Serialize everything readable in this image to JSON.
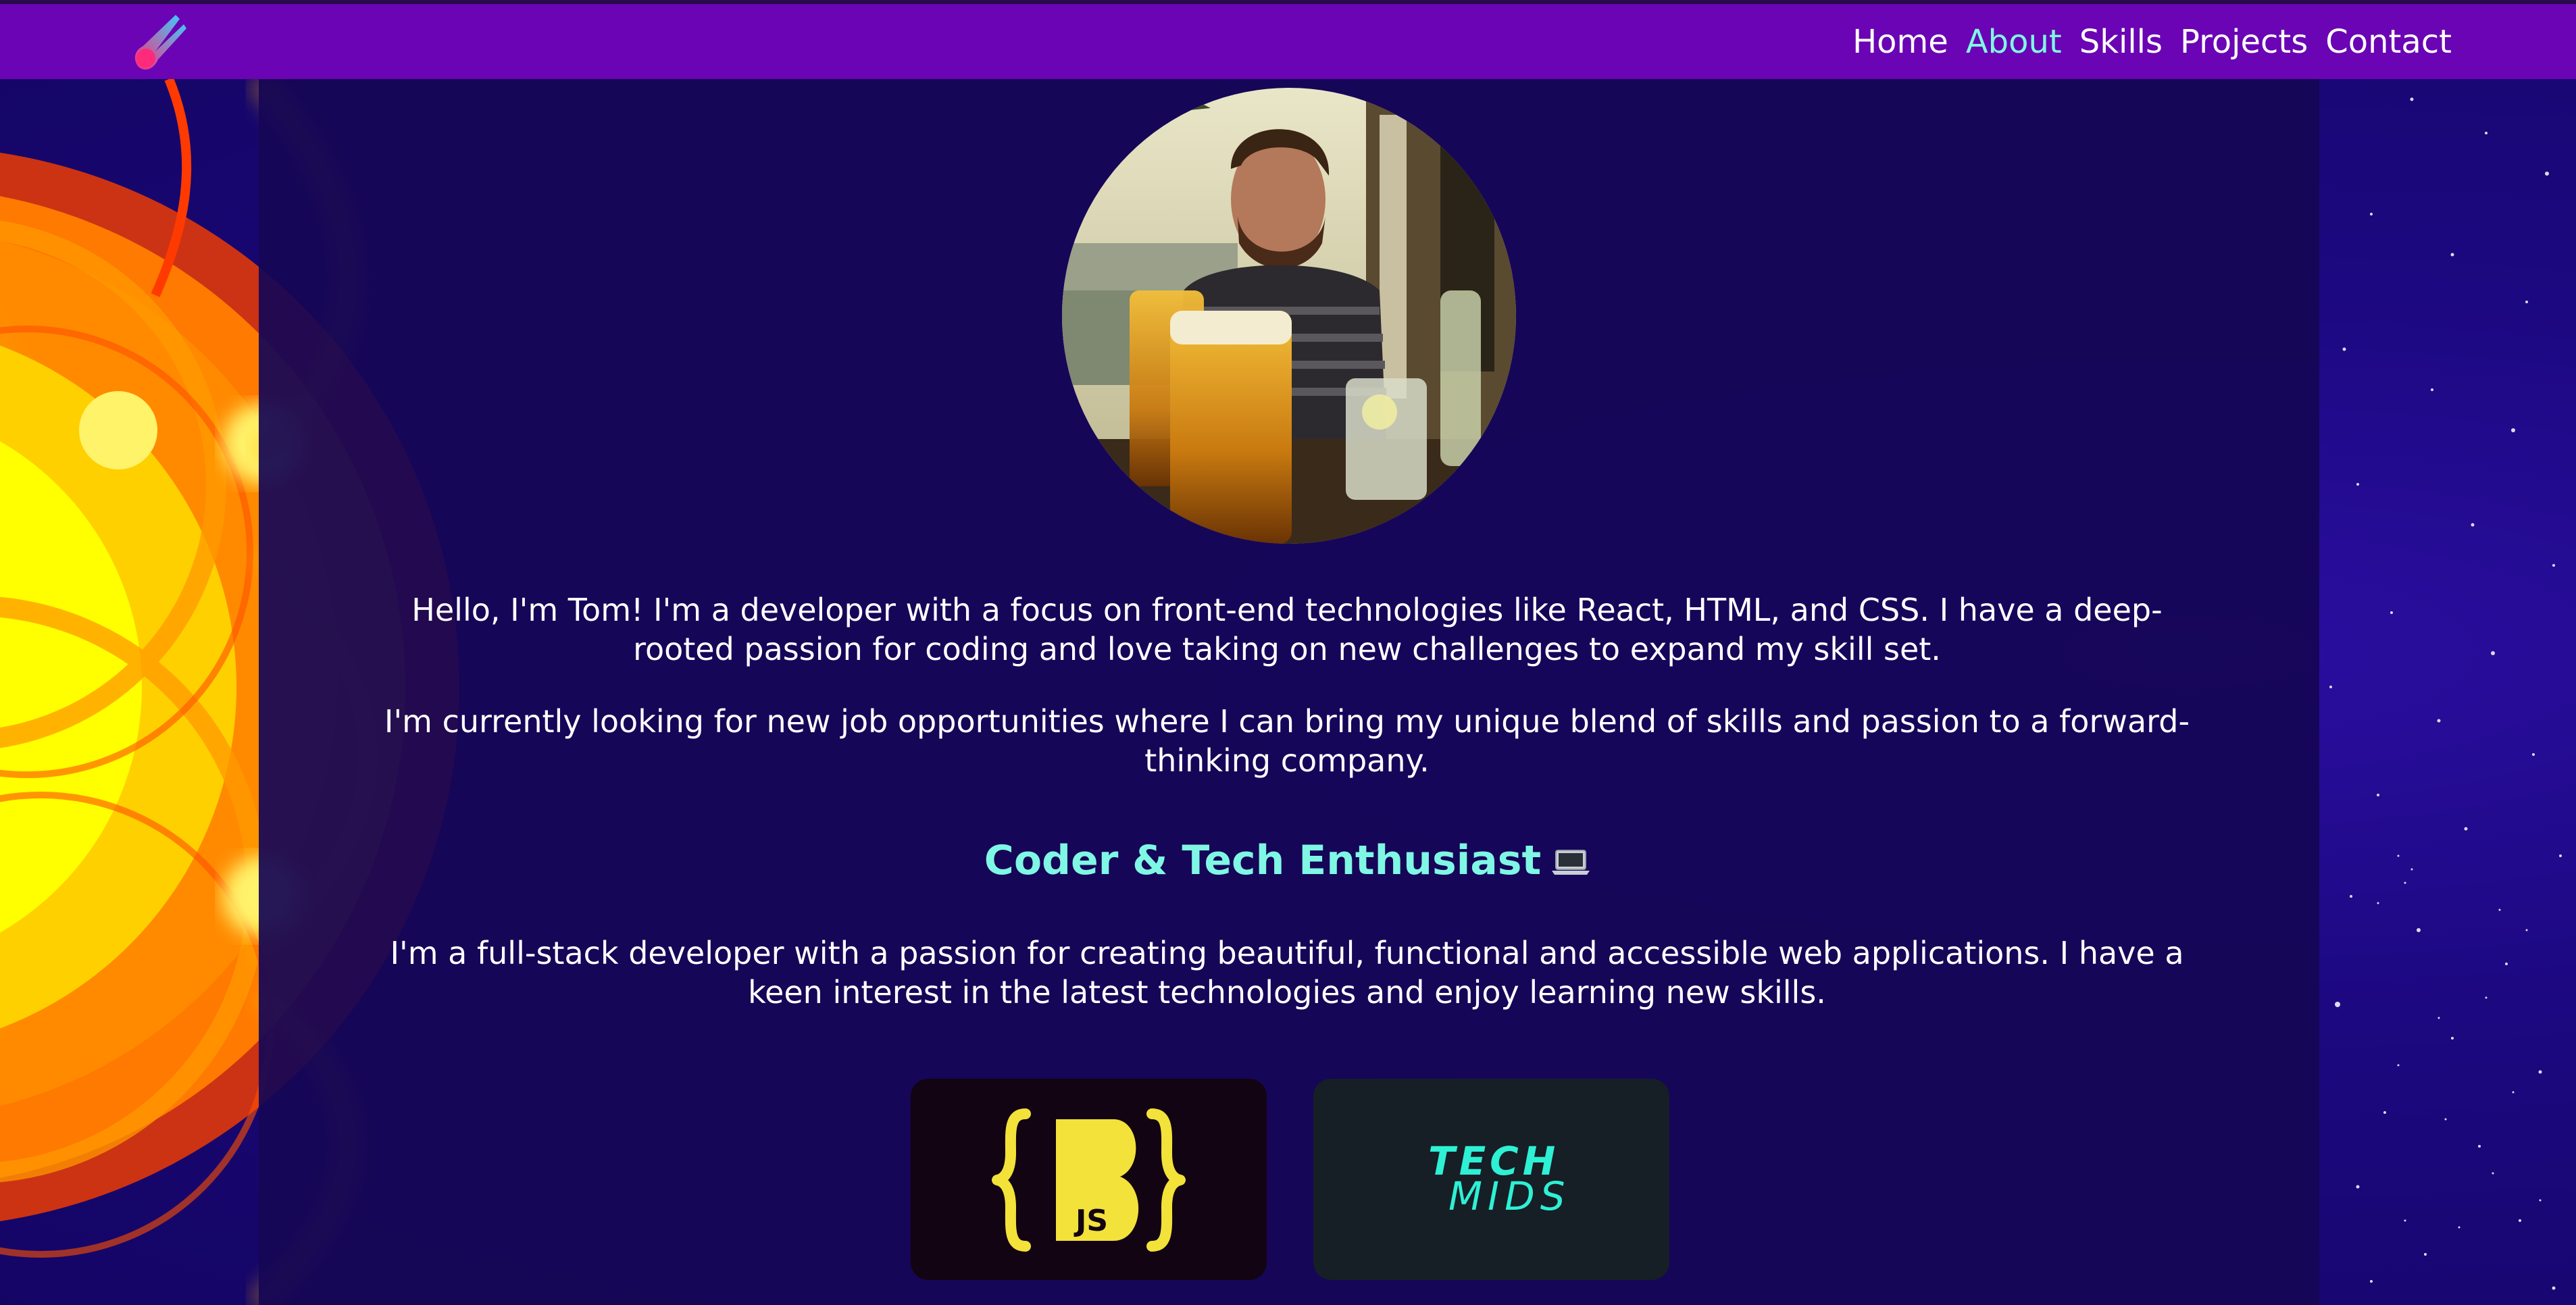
{
  "nav": {
    "logo_icon": "comet-logo-icon",
    "links": [
      {
        "label": "Home",
        "active": false
      },
      {
        "label": "About",
        "active": true
      },
      {
        "label": "Skills",
        "active": false
      },
      {
        "label": "Projects",
        "active": false
      },
      {
        "label": "Contact",
        "active": false
      }
    ]
  },
  "about": {
    "intro": "Hello, I'm Tom! I'm a developer with a focus on front-end technologies like React, HTML, and CSS. I have a deep-rooted passion for coding and love taking on new challenges to expand my skill set.",
    "job_search": "I'm currently looking for new job opportunities where I can bring my unique blend of skills and passion to a forward-thinking company.",
    "heading": "Coder & Tech Enthusiast",
    "heading_icon": "laptop-icon",
    "bio": "I'm a full-stack developer with a passion for creating beautiful, functional and accessible web applications. I have a keen interest in the latest technologies and enjoy learning new skills."
  },
  "badges": [
    {
      "name": "bootcamp-js-logo",
      "text": "JS"
    },
    {
      "name": "tech-mids-logo",
      "line1": "TECH",
      "line2": "MIDS"
    }
  ],
  "colors": {
    "navbar": "#6a04b4",
    "accent": "#7ff7e4",
    "panel": "#160655",
    "badge_yellow": "#f2e23a",
    "badge_teal": "#2ef0d4"
  }
}
